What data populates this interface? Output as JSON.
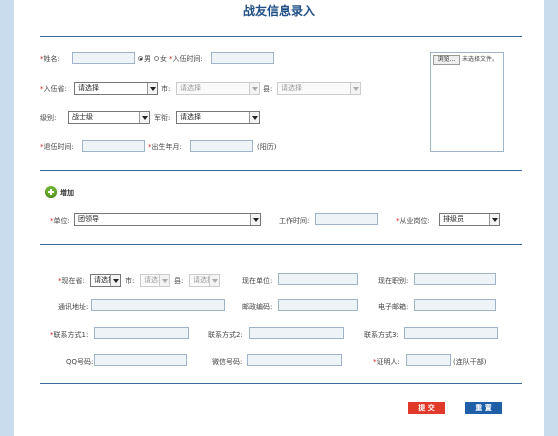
{
  "page": {
    "title": "战友信息录入"
  },
  "colors": {
    "title": "#1f4f86",
    "rule": "#3b6aa0",
    "required": "#d22222",
    "submit": "#e23a2a",
    "reset": "#1f5fa8",
    "background": "#c9dcee"
  },
  "section1": {
    "name_label": "*姓名:",
    "gender": {
      "male": "男",
      "female": "女",
      "selected": "男"
    },
    "enlist_time_label": "*入伍时间:",
    "enlist_province_label": "*入伍省:",
    "enlist_province_value": "请选择",
    "city_label": "市:",
    "city_value": "请选择",
    "county_label": "县:",
    "county_value": "请选择",
    "grade_label": "级别:",
    "grade_value": "战士级",
    "rank_label": "军衔:",
    "rank_value": "请选择",
    "retire_time_label": "*退伍时间:",
    "birth_label": "*出生年月:",
    "birth_note": "(阳历)",
    "browse_label": "浏览...",
    "no_file_text": "未选择文件。"
  },
  "section2": {
    "add_label": "增加",
    "unit_label": "*单位:",
    "unit_value": "团领导",
    "work_time_label": "工作时间:",
    "post_label": "*从业岗位:",
    "post_value": "排级员"
  },
  "section3": {
    "cur_province_label": "*现在省:",
    "cur_province_value": "请选择",
    "city_label": "市:",
    "city_value": "请选择",
    "county_label": "县:",
    "county_value": "请选择",
    "cur_unit_label": "现在单位:",
    "cur_title_label": "现在职别:",
    "address_label": "通讯地址:",
    "zip_label": "邮政编码:",
    "email_label": "电子邮箱:",
    "contact1_label": "*联系方式1:",
    "contact2_label": "联系方式2:",
    "contact3_label": "联系方式3:",
    "qq_label": "QQ号码:",
    "wechat_label": "微信号码:",
    "witness_label": "*证明人:",
    "witness_note": "(连队干部)"
  },
  "buttons": {
    "submit": "提 交",
    "reset": "重 置"
  }
}
